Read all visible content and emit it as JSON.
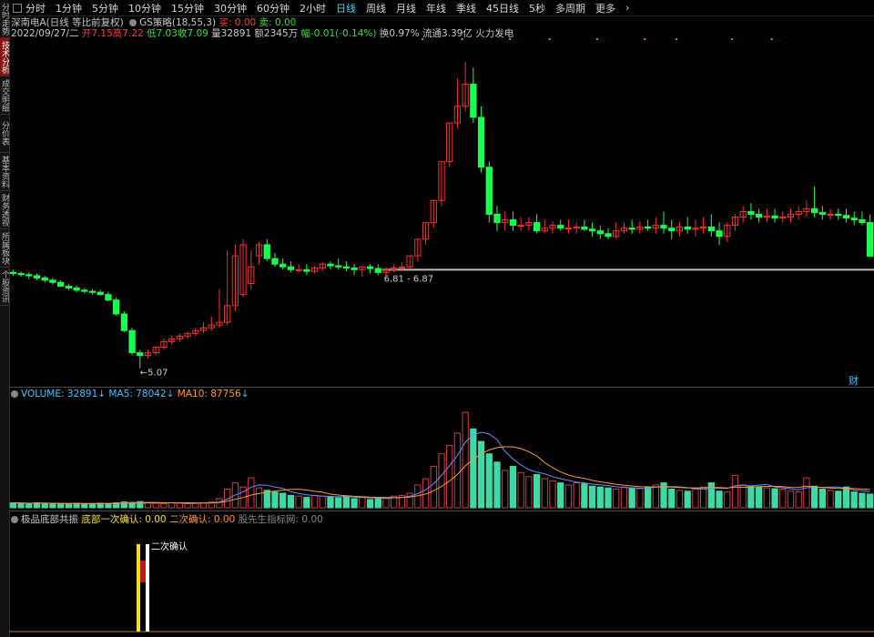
{
  "sidebar": {
    "tabs": [
      "分时走势",
      "技术分析",
      "成交明细",
      "分价表",
      "基本资料",
      "财务透视",
      "所属板块",
      "个股资讯"
    ],
    "active_index": 1
  },
  "topbar": {
    "tabs": [
      "分时",
      "1分钟",
      "5分钟",
      "10分钟",
      "15分钟",
      "30分钟",
      "60分钟",
      "2小时",
      "日线",
      "周线",
      "月线",
      "年线",
      "季线",
      "45日线",
      "5秒",
      "多周期",
      "更多"
    ],
    "active": "日线",
    "more_arrow": "›"
  },
  "stock_header": {
    "name": "深南电A(日线 等比前复权)",
    "indicator_name": "GS策略(18,55,3)",
    "buy_label": "买: 0.00",
    "sell_label": "卖: 0.00"
  },
  "quote_line": {
    "date": "2022/09/27/二",
    "open": "开7.15",
    "high": "高7.22",
    "low": "低7.03",
    "close": "收7.09",
    "volume": "量32891",
    "amount": "额2345万",
    "change": "幅-0.01(-0.14%)",
    "turnover": "换0.97%",
    "float_cap": "流通3.39亿",
    "note": "火力发电"
  },
  "main_chart": {
    "low_marker": "←5.07",
    "range_label": "6.81 - 6.87",
    "corner_badge": "财",
    "colors": {
      "up": "#ff2d2d",
      "down": "#19ff4f",
      "line": "#bdbdbd",
      "bg": "#000000"
    }
  },
  "volume_panel": {
    "label": "VOLUME: 32891",
    "ma5": "MA5: 78042",
    "ma10": "MA10: 87756"
  },
  "indicator_panel": {
    "name": "极品底部共振",
    "first_confirm": "底部一次确认: 0.00",
    "second_confirm": "二次确认: 0.00",
    "watermark": "股先生指标网: 0.00",
    "signal_label": "二次确认"
  },
  "chart_data": [
    {
      "type": "candlestick",
      "title": "深南电A(日线 等比前复权)",
      "open": [
        6.8,
        6.78,
        6.76,
        6.74,
        6.7,
        6.66,
        6.62,
        6.55,
        6.52,
        6.48,
        6.46,
        6.44,
        6.4,
        6.3,
        6.05,
        5.75,
        5.35,
        5.3,
        5.35,
        5.45,
        5.55,
        5.6,
        5.65,
        5.7,
        5.75,
        5.8,
        5.85,
        5.9,
        6.2,
        6.4,
        6.6,
        7.1,
        7.3,
        7.05,
        6.95,
        6.9,
        6.85,
        6.85,
        6.82,
        6.88,
        6.95,
        6.92,
        6.9,
        6.88,
        6.85,
        6.9,
        6.87,
        6.8,
        6.85,
        6.88,
        6.9,
        7.1,
        7.4,
        7.7,
        8.1,
        8.8,
        9.5,
        9.8,
        10.2,
        9.6,
        8.7,
        7.85,
        7.7,
        7.75,
        7.65,
        7.65,
        7.7,
        7.55,
        7.6,
        7.65,
        7.6,
        7.6,
        7.62,
        7.58,
        7.55,
        7.5,
        7.45,
        7.55,
        7.6,
        7.58,
        7.62,
        7.6,
        7.65,
        7.6,
        7.55,
        7.62,
        7.58,
        7.6,
        7.62,
        7.55,
        7.45,
        7.65,
        7.8,
        7.9,
        7.85,
        7.8,
        7.82,
        7.78,
        7.8,
        7.85,
        7.9,
        7.95,
        7.88,
        7.85,
        7.85,
        7.83,
        7.78,
        7.75,
        7.7
      ],
      "high": [
        6.85,
        6.82,
        6.8,
        6.78,
        6.74,
        6.7,
        6.66,
        6.6,
        6.56,
        6.52,
        6.5,
        6.48,
        6.45,
        6.35,
        6.1,
        5.8,
        5.4,
        5.4,
        5.45,
        5.6,
        5.65,
        5.7,
        5.72,
        5.8,
        5.9,
        6.0,
        6.5,
        7.2,
        7.3,
        7.4,
        7.2,
        7.35,
        7.4,
        7.15,
        7.05,
        7.0,
        6.95,
        6.95,
        6.92,
        6.98,
        7.0,
        7.05,
        7.0,
        6.95,
        6.92,
        6.95,
        6.95,
        6.9,
        6.95,
        6.98,
        7.1,
        7.4,
        7.7,
        8.1,
        8.8,
        9.5,
        10.3,
        10.6,
        10.5,
        9.8,
        8.8,
        8.0,
        7.9,
        7.9,
        7.8,
        7.8,
        7.85,
        7.75,
        7.72,
        7.75,
        7.75,
        7.7,
        7.75,
        7.7,
        7.65,
        7.6,
        7.7,
        7.7,
        7.75,
        7.72,
        7.75,
        7.8,
        7.9,
        7.75,
        7.72,
        7.8,
        7.75,
        7.8,
        7.85,
        7.7,
        7.7,
        7.85,
        8.0,
        8.05,
        7.95,
        7.95,
        7.95,
        7.9,
        7.95,
        8.0,
        8.1,
        8.35,
        8.0,
        7.95,
        7.95,
        7.95,
        7.9,
        7.9,
        7.85
      ],
      "low": [
        6.74,
        6.72,
        6.68,
        6.66,
        6.62,
        6.58,
        6.54,
        6.48,
        6.44,
        6.42,
        6.4,
        6.38,
        6.28,
        6.02,
        5.72,
        5.3,
        5.07,
        5.25,
        5.3,
        5.4,
        5.5,
        5.55,
        5.6,
        5.65,
        5.7,
        5.75,
        5.8,
        5.85,
        6.1,
        6.35,
        6.5,
        6.95,
        7.0,
        6.9,
        6.85,
        6.8,
        6.8,
        6.75,
        6.78,
        6.82,
        6.85,
        6.85,
        6.82,
        6.75,
        6.72,
        6.78,
        6.75,
        6.72,
        6.8,
        6.82,
        6.85,
        7.0,
        7.3,
        7.6,
        8.0,
        8.7,
        9.4,
        9.7,
        9.5,
        8.6,
        7.7,
        7.55,
        7.55,
        7.55,
        7.55,
        7.55,
        7.5,
        7.5,
        7.5,
        7.55,
        7.5,
        7.5,
        7.55,
        7.45,
        7.4,
        7.4,
        7.4,
        7.5,
        7.5,
        7.5,
        7.55,
        7.5,
        7.5,
        7.4,
        7.45,
        7.5,
        7.45,
        7.5,
        7.45,
        7.3,
        7.35,
        7.55,
        7.7,
        7.75,
        7.7,
        7.7,
        7.7,
        7.7,
        7.7,
        7.75,
        7.8,
        7.8,
        7.75,
        7.75,
        7.75,
        7.7,
        7.65,
        7.65,
        7.6
      ],
      "close": [
        6.78,
        6.76,
        6.74,
        6.7,
        6.66,
        6.62,
        6.55,
        6.52,
        6.48,
        6.46,
        6.44,
        6.4,
        6.3,
        6.05,
        5.75,
        5.35,
        5.3,
        5.35,
        5.45,
        5.55,
        5.6,
        5.65,
        5.7,
        5.75,
        5.8,
        5.85,
        5.9,
        6.2,
        7.1,
        7.3,
        6.9,
        7.3,
        7.05,
        6.95,
        6.9,
        6.85,
        6.85,
        6.82,
        6.88,
        6.95,
        6.92,
        6.9,
        6.88,
        6.85,
        6.9,
        6.87,
        6.8,
        6.85,
        6.88,
        6.9,
        7.1,
        7.4,
        7.7,
        8.1,
        8.8,
        9.5,
        9.8,
        10.2,
        9.6,
        8.7,
        7.85,
        7.7,
        7.75,
        7.65,
        7.65,
        7.7,
        7.55,
        7.6,
        7.65,
        7.6,
        7.6,
        7.62,
        7.58,
        7.55,
        7.5,
        7.45,
        7.55,
        7.6,
        7.58,
        7.62,
        7.6,
        7.65,
        7.6,
        7.55,
        7.62,
        7.58,
        7.6,
        7.62,
        7.55,
        7.45,
        7.65,
        7.8,
        7.9,
        7.85,
        7.8,
        7.82,
        7.78,
        7.8,
        7.85,
        7.9,
        7.95,
        7.88,
        7.85,
        7.85,
        7.83,
        7.78,
        7.75,
        7.7,
        7.09
      ],
      "ylim": [
        4.9,
        10.7
      ]
    },
    {
      "type": "bar",
      "title": "VOLUME",
      "values": [
        12,
        11,
        10,
        12,
        11,
        10,
        9,
        10,
        11,
        9,
        10,
        11,
        10,
        12,
        14,
        13,
        15,
        12,
        11,
        10,
        12,
        11,
        10,
        11,
        12,
        14,
        22,
        45,
        60,
        50,
        72,
        48,
        42,
        38,
        35,
        30,
        28,
        25,
        30,
        28,
        26,
        24,
        28,
        22,
        25,
        20,
        24,
        22,
        28,
        30,
        35,
        55,
        70,
        100,
        130,
        150,
        180,
        230,
        190,
        160,
        130,
        110,
        90,
        100,
        85,
        75,
        80,
        70,
        65,
        60,
        55,
        60,
        58,
        52,
        50,
        48,
        45,
        50,
        48,
        46,
        50,
        55,
        60,
        45,
        42,
        40,
        45,
        50,
        60,
        40,
        38,
        78,
        55,
        52,
        50,
        48,
        46,
        45,
        40,
        38,
        72,
        52,
        45,
        42,
        40,
        50,
        38,
        35,
        33
      ],
      "ylim": [
        0,
        250
      ]
    }
  ]
}
